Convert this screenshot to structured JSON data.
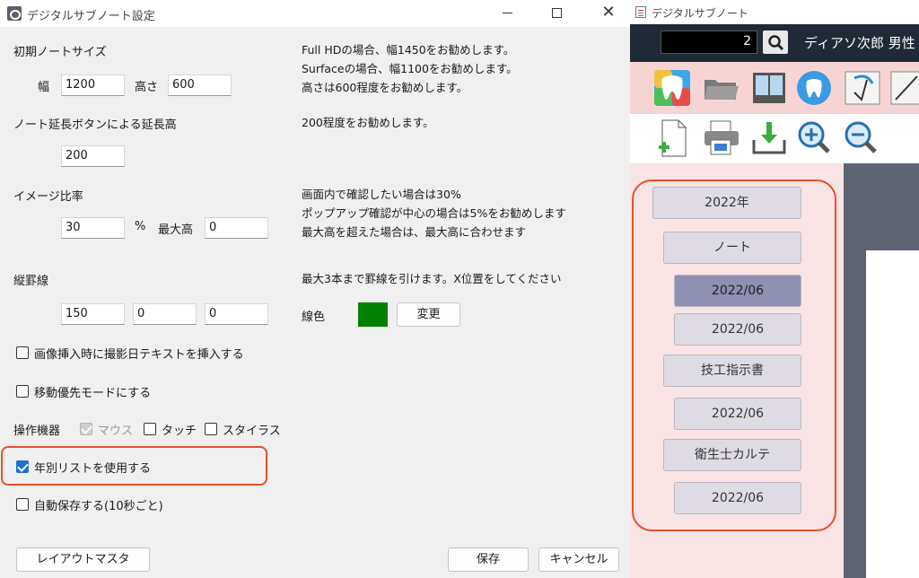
{
  "dialog": {
    "title": "デジタルサブノート設定",
    "initial_size": {
      "label": "初期ノートサイズ",
      "width_label": "幅",
      "width_value": "1200",
      "height_label": "高さ",
      "height_value": "600",
      "hint": [
        "Full HDの場合、幅1450をお勧めします。",
        "Surfaceの場合、幅1100をお勧めします。",
        "高さは600程度をお勧めします。"
      ]
    },
    "extend": {
      "label": "ノート延長ボタンによる延長高",
      "value": "200",
      "hint": "200程度をお勧めします。"
    },
    "image_ratio": {
      "label": "イメージ比率",
      "value": "30",
      "unit": "%",
      "max_label": "最大高",
      "max_value": "0",
      "hint": [
        "画面内で確認したい場合は30%",
        "ポップアップ確認が中心の場合は5%をお勧めします",
        "最大高を超えた場合は、最大高に合わせます"
      ]
    },
    "rules": {
      "label": "縦罫線",
      "values": [
        "150",
        "0",
        "0"
      ],
      "hint": "最大3本まで罫線を引けます。X位置をしてください",
      "color_label": "線色",
      "color": "#008000",
      "change_button": "変更"
    },
    "options": {
      "insert_date": "画像挿入時に撮影日テキストを挿入する",
      "move_priority": "移動優先モードにする",
      "device_label": "操作機器",
      "device_mouse": "マウス",
      "device_touch": "タッチ",
      "device_stylus": "スタイラス",
      "use_year_list": "年別リストを使用する",
      "use_year_list_checked": true,
      "autosave": "自動保存する(10秒ごと)"
    },
    "buttons": {
      "layout_master": "レイアウトマスタ",
      "save": "保存",
      "cancel": "キャンセル"
    }
  },
  "app": {
    "title": "デジタルサブノート",
    "patient_number": "2",
    "patient_name": "ディアソ次郎 男性",
    "toolbar_icons": [
      "tooth-app-icon",
      "folder-icon",
      "window-icon",
      "tooth-icon",
      "draw-icon",
      "line-icon"
    ],
    "toolbar2_icons": [
      "new-page-icon",
      "print-icon",
      "download-icon",
      "zoom-in-icon",
      "zoom-out-icon"
    ],
    "list": [
      "2022年",
      "ノート",
      "2022/06",
      "2022/06",
      "技工指示書",
      "2022/06",
      "衛生士カルテ",
      "2022/06"
    ]
  }
}
